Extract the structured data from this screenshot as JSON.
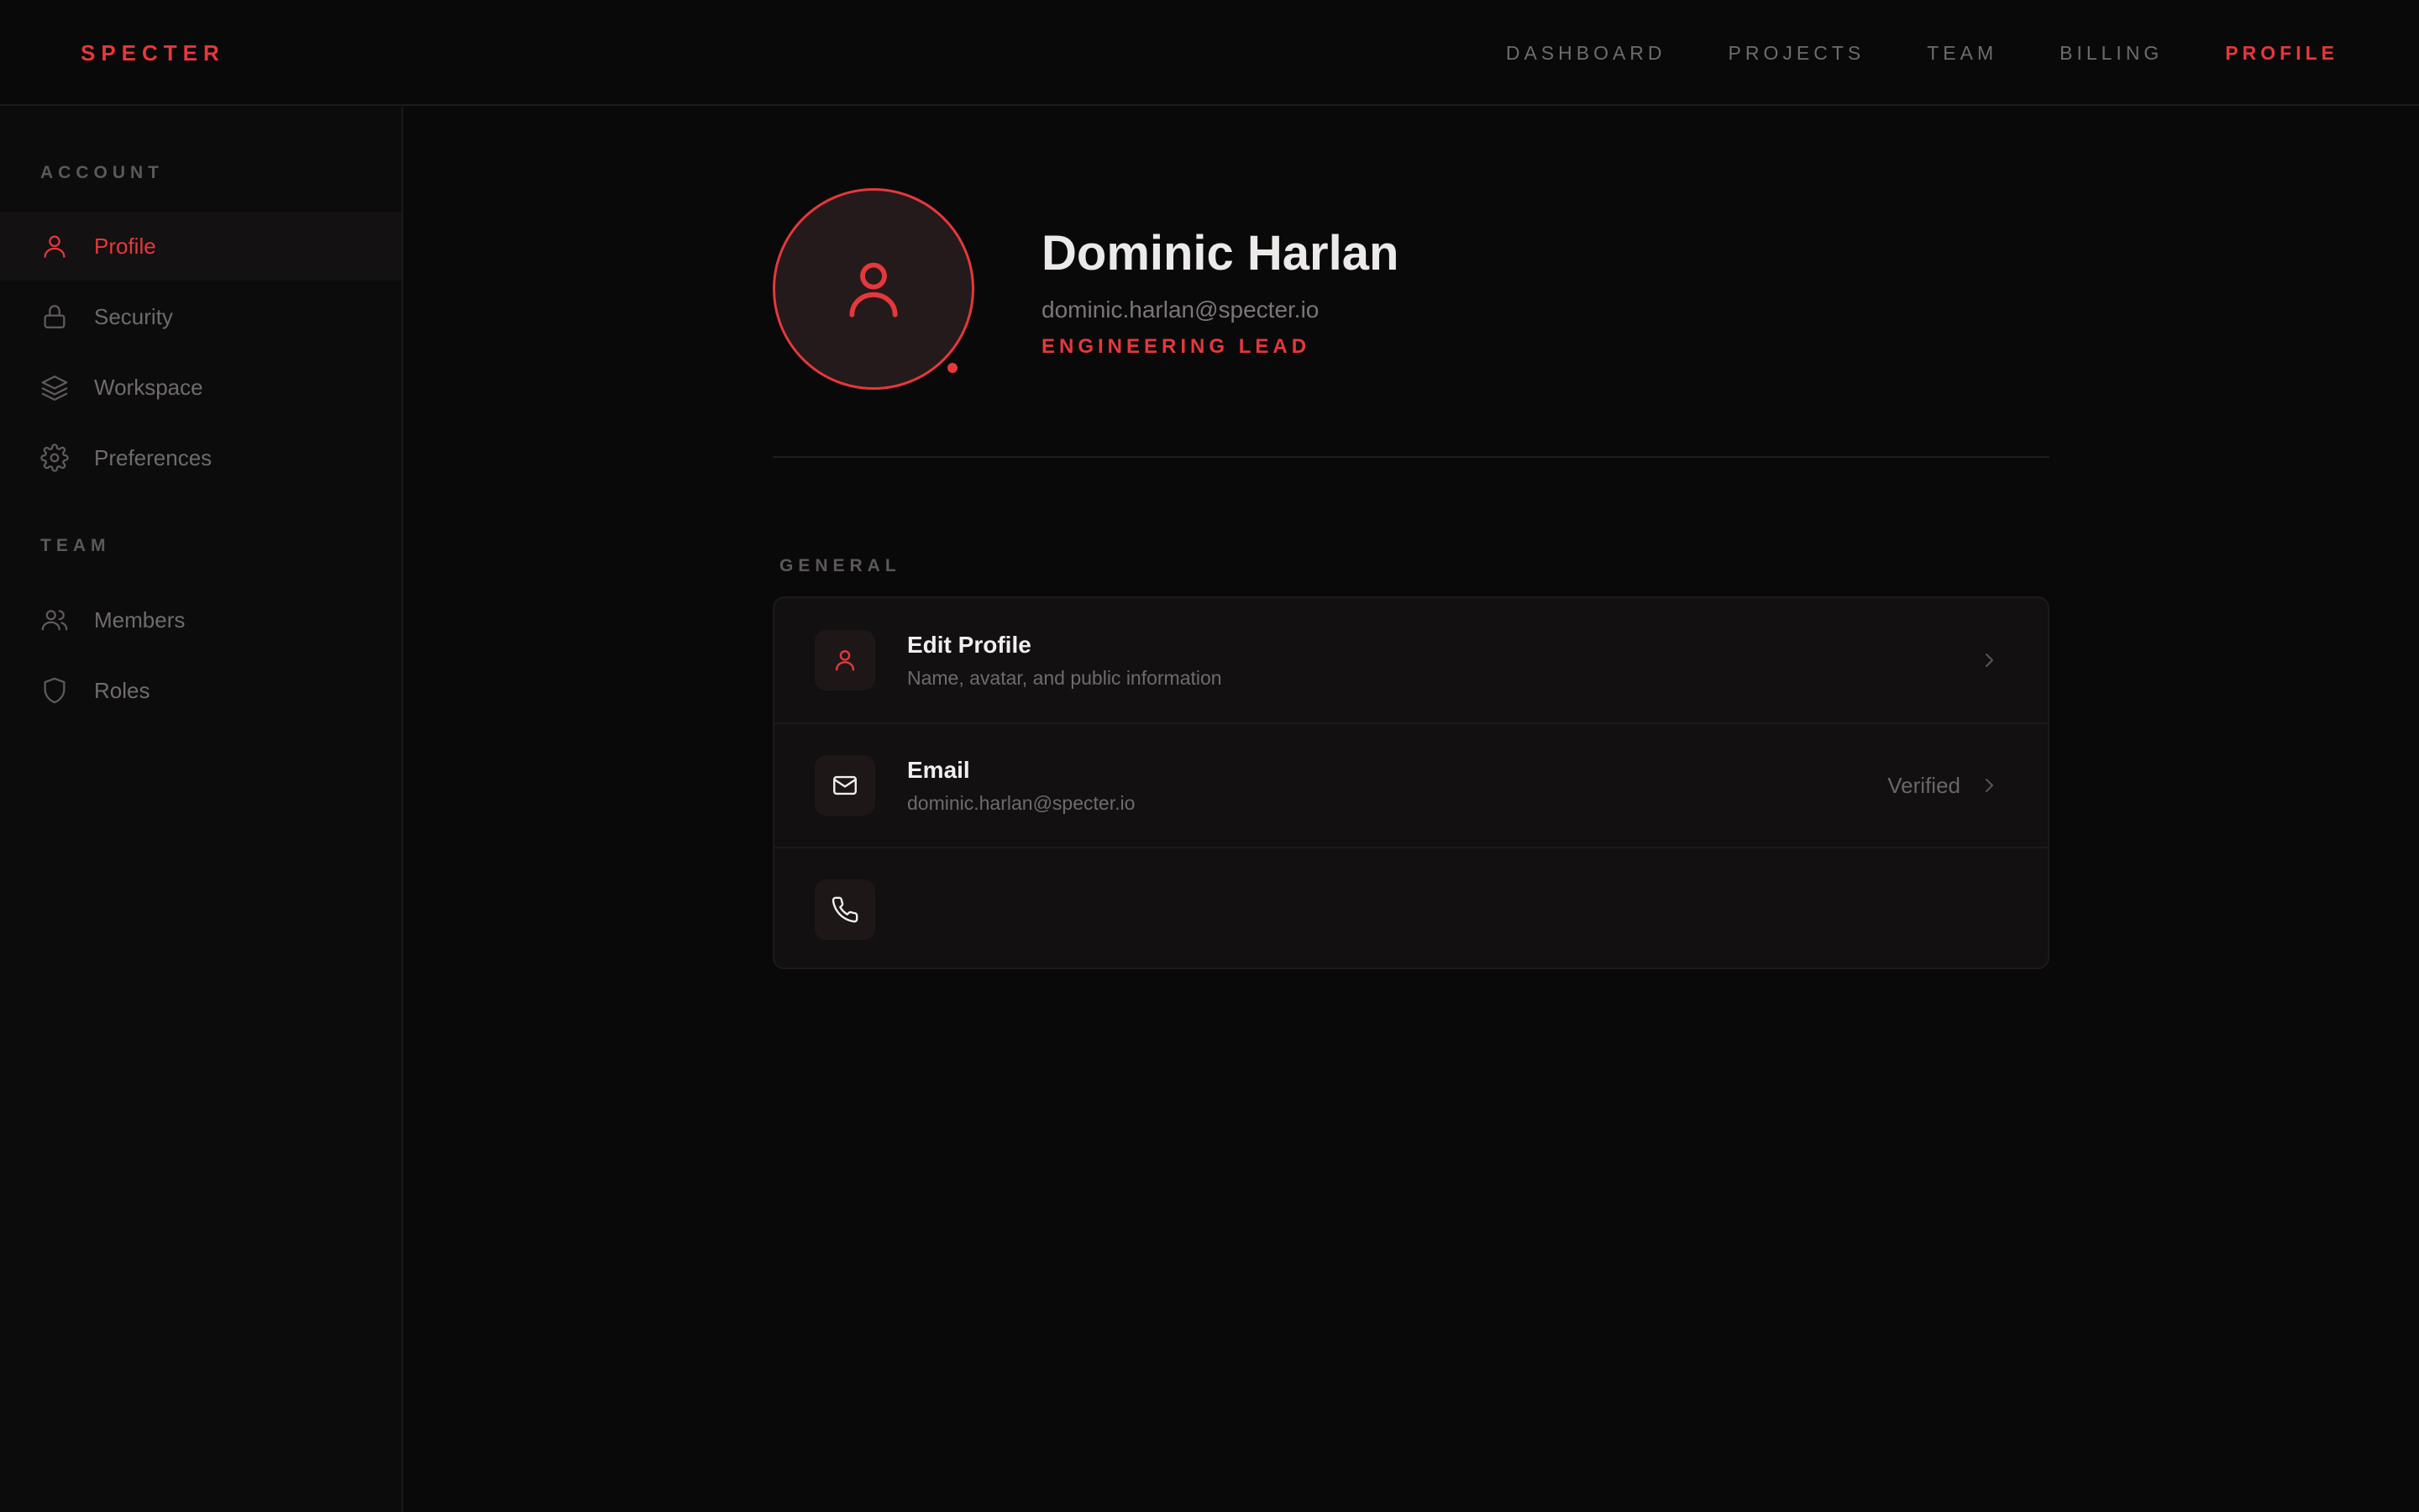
{
  "brand": "SPECTER",
  "topnav": {
    "items": [
      {
        "label": "DASHBOARD",
        "active": false
      },
      {
        "label": "PROJECTS",
        "active": false
      },
      {
        "label": "TEAM",
        "active": false
      },
      {
        "label": "BILLING",
        "active": false
      },
      {
        "label": "PROFILE",
        "active": true
      }
    ]
  },
  "sidebar": {
    "account_title": "ACCOUNT",
    "account_items": [
      {
        "label": "Profile",
        "icon": "user-icon",
        "active": true
      },
      {
        "label": "Security",
        "icon": "lock-icon",
        "active": false
      },
      {
        "label": "Workspace",
        "icon": "layers-icon",
        "active": false
      },
      {
        "label": "Preferences",
        "icon": "gear-icon",
        "active": false
      }
    ],
    "team_title": "TEAM",
    "team_items": [
      {
        "label": "Members",
        "icon": "users-icon",
        "active": false
      },
      {
        "label": "Roles",
        "icon": "shield-icon",
        "active": false
      }
    ]
  },
  "profile": {
    "name": "Dominic Harlan",
    "email": "dominic.harlan@specter.io",
    "role": "ENGINEERING LEAD",
    "avatar_icon": "user-icon",
    "status": "online"
  },
  "general": {
    "title": "GENERAL",
    "rows": [
      {
        "title": "Edit Profile",
        "subtitle": "Name, avatar, and public information",
        "icon": "user-icon",
        "meta": ""
      },
      {
        "title": "Email",
        "subtitle": "dominic.harlan@specter.io",
        "icon": "mail-icon",
        "meta": "Verified"
      },
      {
        "title": "",
        "subtitle": "",
        "icon": "phone-icon",
        "meta": ""
      }
    ]
  },
  "colors": {
    "accent": "#e5383b",
    "background": "#0a090a",
    "sidebar": "#0d0c0d",
    "card": "#121011"
  }
}
